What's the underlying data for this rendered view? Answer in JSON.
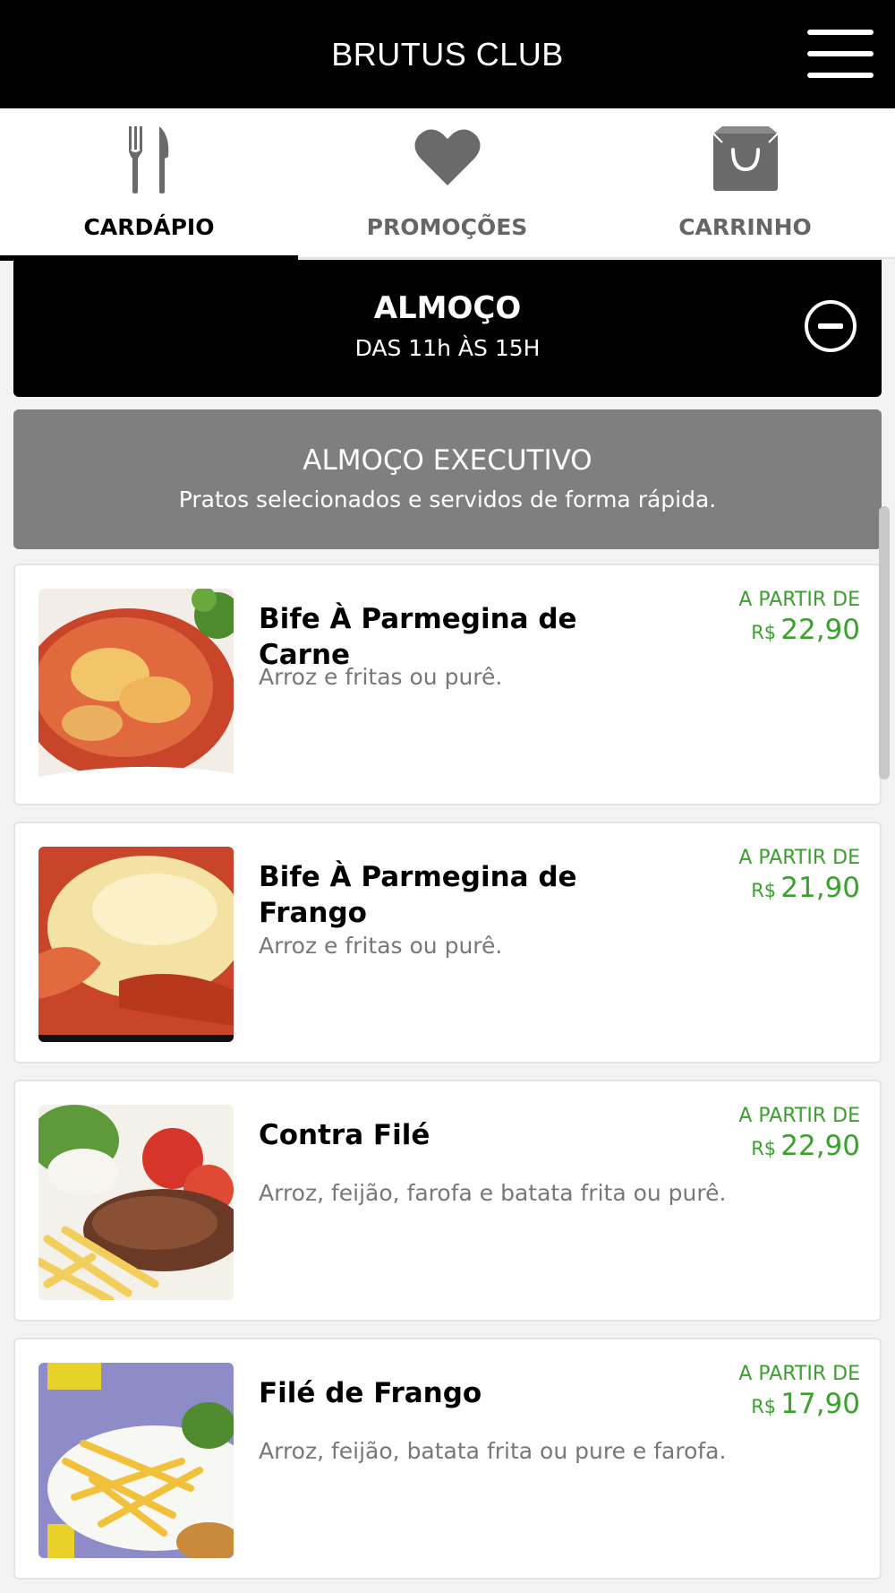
{
  "header": {
    "title": "BRUTUS CLUB",
    "menu_icon": "hamburger-menu-icon"
  },
  "tabs": [
    {
      "label": "CARDÁPIO",
      "icon": "fork-knife-icon",
      "active": true
    },
    {
      "label": "PROMOÇÕES",
      "icon": "heart-icon",
      "active": false
    },
    {
      "label": "CARRINHO",
      "icon": "shopping-bag-icon",
      "active": false
    }
  ],
  "section": {
    "title": "ALMOÇO",
    "subtitle": "DAS 11h ÀS 15H",
    "collapse_icon": "minus-circle-icon"
  },
  "category": {
    "title": "ALMOÇO EXECUTIVO",
    "description": "Pratos selecionados e servidos de forma rápida."
  },
  "items": [
    {
      "name": "Bife À Parmegina de Carne",
      "description": "Arroz e fritas ou purê.",
      "from_label": "A PARTIR DE",
      "currency": "R$",
      "price": "22,90"
    },
    {
      "name": "Bife À Parmegina de Frango",
      "description": "Arroz e fritas ou purê.",
      "from_label": "A PARTIR DE",
      "currency": "R$",
      "price": "21,90"
    },
    {
      "name": "Contra Filé",
      "description": "Arroz, feijão, farofa e batata frita ou purê.",
      "from_label": "A PARTIR DE",
      "currency": "R$",
      "price": "22,90"
    },
    {
      "name": "Filé de Frango",
      "description": "Arroz, feijão, batata frita ou pure e farofa.",
      "from_label": "A PARTIR DE",
      "currency": "R$",
      "price": "17,90"
    }
  ],
  "colors": {
    "header_bg": "#000000",
    "category_bg": "#7f7f7f",
    "price_green": "#3aa12c",
    "tab_inactive": "#666666"
  }
}
